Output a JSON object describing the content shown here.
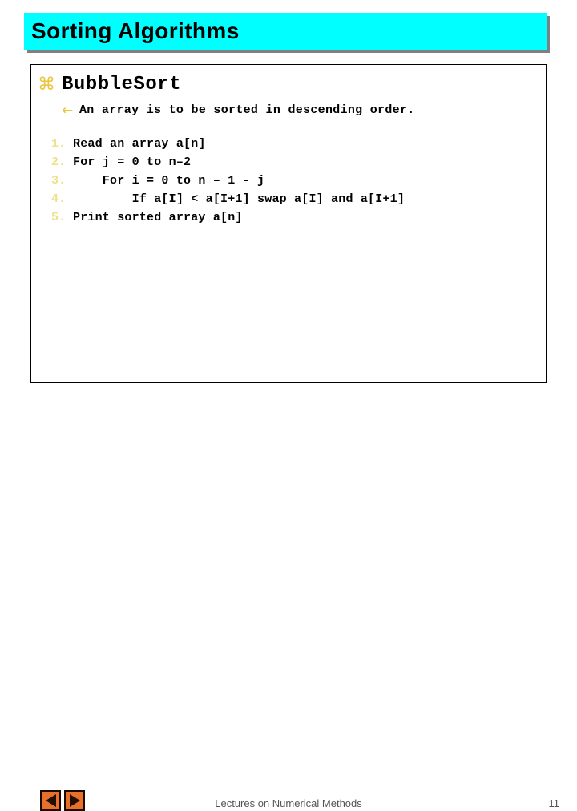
{
  "slide": {
    "title": "Sorting Algorithms",
    "title_bg_color": "#00ffff",
    "title_shadow_color": "#808080"
  },
  "content": {
    "bullet_level1": {
      "icon": "place-of-interest-bullet",
      "glyph": "⌘",
      "color": "#ebc43c",
      "label": "BubbleSort"
    },
    "bullet_level2": {
      "icon": "left-arrow-bullet",
      "glyph": "←",
      "color": "#ebc43c",
      "label": "An array is to be sorted in descending order."
    },
    "algorithm_steps": [
      {
        "number": "1.",
        "text": "Read an array a[n]"
      },
      {
        "number": "2.",
        "text": "For j = 0 to n–2"
      },
      {
        "number": "3.",
        "text": "    For i = 0 to n – 1 - j"
      },
      {
        "number": "4.",
        "text": "        If a[I] < a[I+1] swap a[I] and a[I+1]"
      },
      {
        "number": "5.",
        "text": "Print sorted array a[n]"
      }
    ],
    "step_number_color": "#efe08a"
  },
  "footer": {
    "prev_button": {
      "icon": "triangle-left-icon",
      "label": "Previous slide"
    },
    "next_button": {
      "icon": "triangle-right-icon",
      "label": "Next slide"
    },
    "center_label": "Lectures on Numerical Methods",
    "page_number": "11",
    "button_color": "#e8702a",
    "text_color": "#555555"
  }
}
